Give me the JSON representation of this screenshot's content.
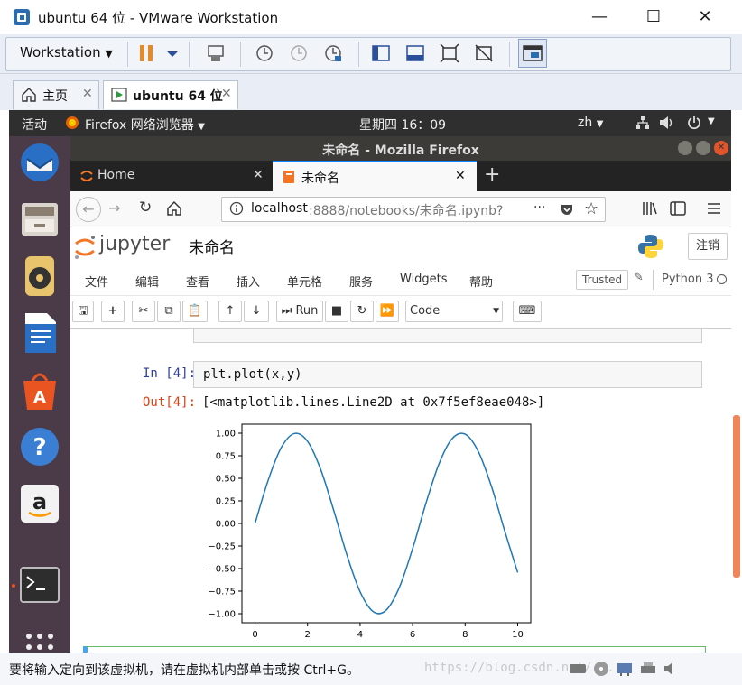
{
  "vm_window": {
    "title": "ubuntu 64 位 - VMware Workstation",
    "menu_label": "Workstation",
    "tabs": [
      {
        "label": "主页"
      },
      {
        "label": "ubuntu 64 位"
      }
    ],
    "status_message": "要将输入定向到该虚拟机，请在虚拟机内部单击或按 Ctrl+G。",
    "watermark": "https://blog.csdn.net/..."
  },
  "gnome_bar": {
    "activities": "活动",
    "app_menu": "Firefox 网络浏览器",
    "clock": "星期四 16：09",
    "input_method": "zh"
  },
  "firefox": {
    "window_title": "未命名 - Mozilla Firefox",
    "tabs": [
      {
        "label": "Home"
      },
      {
        "label": "未命名"
      }
    ],
    "url_host": "localhost",
    "url_rest": ":8888/notebooks/未命名.ipynb?",
    "url_more": "···"
  },
  "jupyter": {
    "logo_text": "jupyter",
    "notebook_name": "未命名",
    "logout_label": "注销",
    "menu": [
      "文件",
      "编辑",
      "查看",
      "插入",
      "单元格",
      "服务",
      "Widgets",
      "帮助"
    ],
    "trusted_label": "Trusted",
    "kernel_name": "Python 3",
    "run_label": "Run",
    "cell_type": "Code",
    "cells": [
      {
        "prompt_in": "In [4]:",
        "code": "plt.plot(x,y)",
        "prompt_out": "Out[4]:",
        "output": "[<matplotlib.lines.Line2D at 0x7f5ef8eae048>]"
      }
    ]
  },
  "chart_data": {
    "type": "line",
    "title": "",
    "xlabel": "",
    "ylabel": "",
    "xlim": [
      0,
      10
    ],
    "ylim": [
      -1.0,
      1.0
    ],
    "x_ticks": [
      "0",
      "2",
      "4",
      "6",
      "8",
      "10"
    ],
    "y_ticks": [
      "1.00",
      "0.75",
      "0.50",
      "0.25",
      "0.00",
      "−0.25",
      "−0.50",
      "−0.75",
      "−1.00"
    ],
    "grid": false,
    "series": [
      {
        "color": "#1f77b4",
        "x": [
          0,
          0.5,
          1,
          1.5,
          2,
          2.5,
          3,
          3.5,
          4,
          4.5,
          5,
          5.5,
          6,
          6.5,
          7,
          7.5,
          8,
          8.5,
          9,
          9.5,
          10
        ],
        "y": [
          0,
          0.479,
          0.841,
          0.997,
          0.909,
          0.598,
          0.141,
          -0.351,
          -0.757,
          -0.978,
          -0.959,
          -0.706,
          -0.279,
          0.215,
          0.657,
          0.938,
          0.989,
          0.798,
          0.412,
          -0.075,
          -0.544
        ]
      }
    ]
  },
  "colors": {
    "gnome_bar": "#2f2f2f",
    "dock": "#4b3a47",
    "firefox_title": "#3c3b37",
    "jupyter_orange": "#f37626",
    "prompt_in": "#303f9f",
    "prompt_out": "#d84315",
    "line": "#1f77b4"
  }
}
